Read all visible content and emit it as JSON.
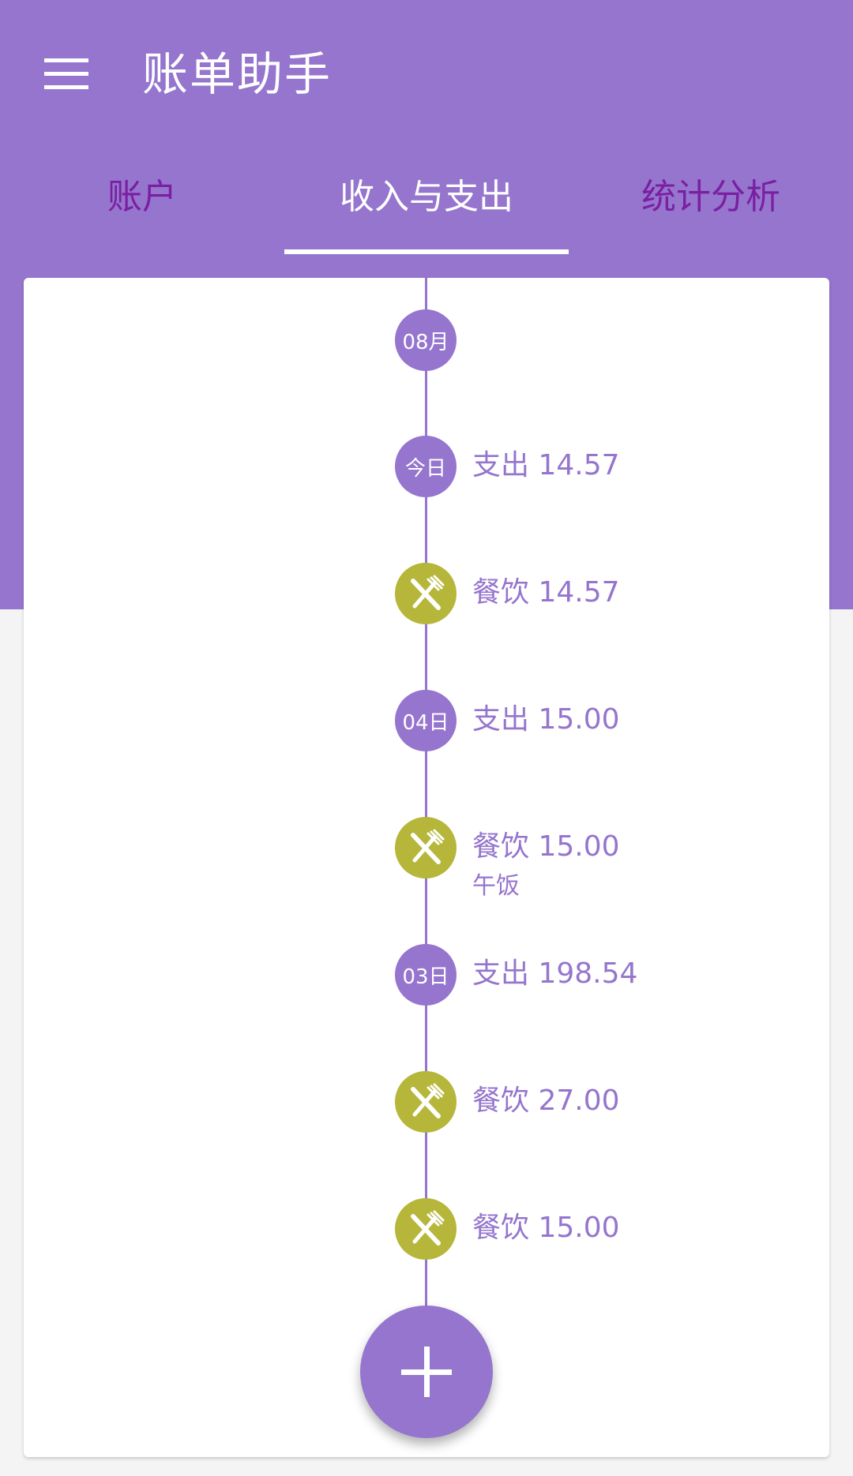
{
  "app_bar": {
    "title": "账单助手",
    "menu_icon": "hamburger-menu-icon"
  },
  "tabs": [
    {
      "label": "账户",
      "active": false
    },
    {
      "label": "收入与支出",
      "active": true
    },
    {
      "label": "统计分析",
      "active": false
    }
  ],
  "timeline": {
    "month_label": "08月",
    "entries": [
      {
        "type": "day",
        "badge": "今日",
        "text": "支出 14.57"
      },
      {
        "type": "record",
        "icon": "utensils-icon",
        "text": "餐饮 14.57"
      },
      {
        "type": "day",
        "badge": "04日",
        "text": "支出 15.00"
      },
      {
        "type": "record",
        "icon": "utensils-icon",
        "text": "餐饮 15.00",
        "note": "午饭"
      },
      {
        "type": "day",
        "badge": "03日",
        "text": "支出 198.54"
      },
      {
        "type": "record",
        "icon": "utensils-icon",
        "text": "餐饮 27.00"
      },
      {
        "type": "record",
        "icon": "utensils-icon",
        "text": "餐饮 15.00"
      }
    ]
  },
  "fab": {
    "icon": "plus-icon"
  },
  "colors": {
    "primary": "#9575cd",
    "category_food": "#b6b63a",
    "tab_inactive": "#7b1fa2",
    "background": "#f4f4f4"
  }
}
